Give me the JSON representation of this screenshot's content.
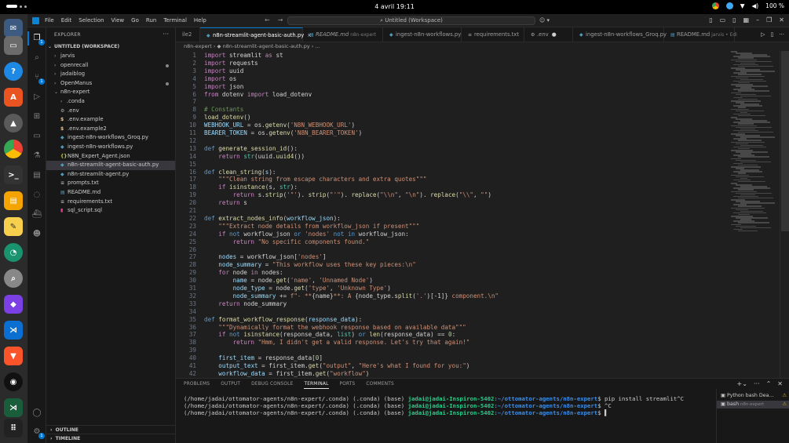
{
  "topbar": {
    "clock": "4 avril  19:11",
    "battery": "100 %"
  },
  "titlebar": {
    "menu": [
      "File",
      "Edit",
      "Selection",
      "View",
      "Go",
      "Run",
      "Terminal",
      "Help"
    ],
    "command_center": "Untitled (Workspace)"
  },
  "activity_badges": {
    "explorer": "1",
    "source_control": "1",
    "accounts": "1"
  },
  "explorer": {
    "header": "EXPLORER",
    "workspace": "UNTITLED (WORKSPACE)",
    "items": [
      {
        "label": "jarvis",
        "type": "folder",
        "open": false,
        "depth": 1
      },
      {
        "label": "openrecall",
        "type": "folder",
        "open": false,
        "depth": 1,
        "modified": true
      },
      {
        "label": "jadaiblog",
        "type": "folder",
        "open": false,
        "depth": 1
      },
      {
        "label": "OpenManus",
        "type": "folder",
        "open": false,
        "depth": 1,
        "modified": true
      },
      {
        "label": "n8n-expert",
        "type": "folder",
        "open": true,
        "depth": 1
      },
      {
        "label": ".conda",
        "type": "folder",
        "open": false,
        "depth": 2
      },
      {
        "label": ".env",
        "type": "gear",
        "depth": 2
      },
      {
        "label": ".env.example",
        "type": "dollar",
        "depth": 2
      },
      {
        "label": ".env.example2",
        "type": "dollar",
        "depth": 2
      },
      {
        "label": "ingest-n8n-workflows_Groq.py",
        "type": "py",
        "depth": 2
      },
      {
        "label": "ingest-n8n-workflows.py",
        "type": "py",
        "depth": 2
      },
      {
        "label": "N8N_Expert_Agent.json",
        "type": "json",
        "depth": 2
      },
      {
        "label": "n8n-streamlit-agent-basic-auth.py",
        "type": "py",
        "depth": 2,
        "selected": true
      },
      {
        "label": "n8n-streamlit-agent.py",
        "type": "py",
        "depth": 2
      },
      {
        "label": "prompts.txt",
        "type": "txt",
        "depth": 2
      },
      {
        "label": "README.md",
        "type": "md",
        "depth": 2
      },
      {
        "label": "requirements.txt",
        "type": "txt",
        "depth": 2
      },
      {
        "label": "sql_script.sql",
        "type": "sql",
        "depth": 2
      }
    ],
    "outline": "OUTLINE",
    "timeline": "TIMELINE"
  },
  "tabs": [
    {
      "label": "ile2",
      "icon": "",
      "active": false
    },
    {
      "label": "n8n-streamlit-agent-basic-auth.py",
      "icon": "py",
      "active": true,
      "close": "×"
    },
    {
      "label": "README.md",
      "desc": "n8n-expert",
      "icon": "md",
      "italic": true
    },
    {
      "label": "ingest-n8n-workflows.py",
      "icon": "py"
    },
    {
      "label": "requirements.txt",
      "icon": "txt"
    },
    {
      "label": ".env",
      "icon": "gear",
      "dirty": true
    },
    {
      "label": "ingest-n8n-workflows_Groq.py",
      "icon": "py"
    },
    {
      "label": "README.md",
      "desc": "jarvis • Edi",
      "icon": "md"
    }
  ],
  "breadcrumb": "n8n-expert  ›  ◆ n8n-streamlit-agent-basic-auth.py  ›  ...",
  "code": [
    [
      [
        "k",
        "import"
      ],
      [
        "t",
        " streamlit "
      ],
      [
        "k",
        "as"
      ],
      [
        "t",
        " st"
      ]
    ],
    [
      [
        "k",
        "import"
      ],
      [
        "t",
        " requests"
      ]
    ],
    [
      [
        "k",
        "import"
      ],
      [
        "t",
        " uuid"
      ]
    ],
    [
      [
        "k",
        "import"
      ],
      [
        "t",
        " os"
      ]
    ],
    [
      [
        "k",
        "import"
      ],
      [
        "t",
        " json"
      ]
    ],
    [
      [
        "k",
        "from"
      ],
      [
        "t",
        " dotenv "
      ],
      [
        "k",
        "import"
      ],
      [
        "t",
        " load_dotenv"
      ]
    ],
    [],
    [
      [
        "c",
        "# Constants"
      ]
    ],
    [
      [
        "f",
        "load_dotenv"
      ],
      [
        "t",
        "()"
      ]
    ],
    [
      [
        "v",
        "WEBHOOK_URL"
      ],
      [
        "t",
        " = os."
      ],
      [
        "f",
        "getenv"
      ],
      [
        "t",
        "("
      ],
      [
        "s",
        "'N8N_WEBHOOK_URL'"
      ],
      [
        "t",
        ")"
      ]
    ],
    [
      [
        "v",
        "BEARER_TOKEN"
      ],
      [
        "t",
        " = os."
      ],
      [
        "f",
        "getenv"
      ],
      [
        "t",
        "("
      ],
      [
        "s",
        "'N8N_BEARER_TOKEN'"
      ],
      [
        "t",
        ")"
      ]
    ],
    [],
    [
      [
        "kd",
        "def"
      ],
      [
        "t",
        " "
      ],
      [
        "f",
        "generate_session_id"
      ],
      [
        "t",
        "():"
      ]
    ],
    [
      [
        "t",
        "    "
      ],
      [
        "k",
        "return"
      ],
      [
        "t",
        " "
      ],
      [
        "cls",
        "str"
      ],
      [
        "t",
        "(uuid."
      ],
      [
        "f",
        "uuid4"
      ],
      [
        "t",
        "())"
      ]
    ],
    [],
    [
      [
        "kd",
        "def"
      ],
      [
        "t",
        " "
      ],
      [
        "f",
        "clean_string"
      ],
      [
        "t",
        "("
      ],
      [
        "v",
        "s"
      ],
      [
        "t",
        "):"
      ]
    ],
    [
      [
        "t",
        "    "
      ],
      [
        "s",
        "\"\"\"Clean string from escape characters and extra quotes\"\"\""
      ]
    ],
    [
      [
        "t",
        "    "
      ],
      [
        "k",
        "if"
      ],
      [
        "t",
        " "
      ],
      [
        "f",
        "isinstance"
      ],
      [
        "t",
        "(s, "
      ],
      [
        "cls",
        "str"
      ],
      [
        "t",
        "):"
      ]
    ],
    [
      [
        "t",
        "        "
      ],
      [
        "k",
        "return"
      ],
      [
        "t",
        " s."
      ],
      [
        "f",
        "strip"
      ],
      [
        "t",
        "("
      ],
      [
        "s",
        "'\"'"
      ],
      [
        "t",
        "). "
      ],
      [
        "f",
        "strip"
      ],
      [
        "t",
        "("
      ],
      [
        "s",
        "\"'\""
      ],
      [
        "t",
        "). "
      ],
      [
        "f",
        "replace"
      ],
      [
        "t",
        "("
      ],
      [
        "s",
        "\"\\\\n\""
      ],
      [
        "t",
        ", "
      ],
      [
        "s",
        "\"\\n\""
      ],
      [
        "t",
        "). "
      ],
      [
        "f",
        "replace"
      ],
      [
        "t",
        "("
      ],
      [
        "s",
        "\"\\\\\""
      ],
      [
        "t",
        ", "
      ],
      [
        "s",
        "\"\""
      ],
      [
        "t",
        ")"
      ]
    ],
    [
      [
        "t",
        "    "
      ],
      [
        "k",
        "return"
      ],
      [
        "t",
        " s"
      ]
    ],
    [],
    [
      [
        "kd",
        "def"
      ],
      [
        "t",
        " "
      ],
      [
        "f",
        "extract_nodes_info"
      ],
      [
        "t",
        "("
      ],
      [
        "v",
        "workflow_json"
      ],
      [
        "t",
        "):"
      ]
    ],
    [
      [
        "t",
        "    "
      ],
      [
        "s",
        "\"\"\"Extract node details from workflow_json if present\"\"\""
      ]
    ],
    [
      [
        "t",
        "    "
      ],
      [
        "k",
        "if"
      ],
      [
        "t",
        " "
      ],
      [
        "kd",
        "not"
      ],
      [
        "t",
        " workflow_json "
      ],
      [
        "kd",
        "or"
      ],
      [
        "t",
        " "
      ],
      [
        "s",
        "'nodes'"
      ],
      [
        "t",
        " "
      ],
      [
        "kd",
        "not in"
      ],
      [
        "t",
        " workflow_json:"
      ]
    ],
    [
      [
        "t",
        "        "
      ],
      [
        "k",
        "return"
      ],
      [
        "t",
        " "
      ],
      [
        "s",
        "\"No specific components found.\""
      ]
    ],
    [],
    [
      [
        "t",
        "    "
      ],
      [
        "v",
        "nodes"
      ],
      [
        "t",
        " = workflow_json["
      ],
      [
        "s",
        "'nodes'"
      ],
      [
        "t",
        "]"
      ]
    ],
    [
      [
        "t",
        "    "
      ],
      [
        "v",
        "node_summary"
      ],
      [
        "t",
        " = "
      ],
      [
        "s",
        "\"This workflow uses these key pieces:\\n\""
      ]
    ],
    [
      [
        "t",
        "    "
      ],
      [
        "k",
        "for"
      ],
      [
        "t",
        " node "
      ],
      [
        "k",
        "in"
      ],
      [
        "t",
        " nodes:"
      ]
    ],
    [
      [
        "t",
        "        "
      ],
      [
        "v",
        "name"
      ],
      [
        "t",
        " = node."
      ],
      [
        "f",
        "get"
      ],
      [
        "t",
        "("
      ],
      [
        "s",
        "'name'"
      ],
      [
        "t",
        ", "
      ],
      [
        "s",
        "'Unnamed Node'"
      ],
      [
        "t",
        ")"
      ]
    ],
    [
      [
        "t",
        "        "
      ],
      [
        "v",
        "node_type"
      ],
      [
        "t",
        " = node."
      ],
      [
        "f",
        "get"
      ],
      [
        "t",
        "("
      ],
      [
        "s",
        "'type'"
      ],
      [
        "t",
        ", "
      ],
      [
        "s",
        "'Unknown Type'"
      ],
      [
        "t",
        ")"
      ]
    ],
    [
      [
        "t",
        "        "
      ],
      [
        "v",
        "node_summary"
      ],
      [
        "t",
        " += "
      ],
      [
        "s",
        "f\"- **"
      ],
      [
        "t",
        "{name}"
      ],
      [
        "s",
        "**: A "
      ],
      [
        "t",
        "{node_type."
      ],
      [
        "f",
        "split"
      ],
      [
        "t",
        "("
      ],
      [
        "s",
        "'.'"
      ],
      [
        "t",
        ")[-1]}"
      ],
      [
        "s",
        " component.\\n\""
      ]
    ],
    [
      [
        "t",
        "    "
      ],
      [
        "k",
        "return"
      ],
      [
        "t",
        " node_summary"
      ]
    ],
    [],
    [
      [
        "kd",
        "def"
      ],
      [
        "t",
        " "
      ],
      [
        "f",
        "format_workflow_response"
      ],
      [
        "t",
        "("
      ],
      [
        "v",
        "response_data"
      ],
      [
        "t",
        "):"
      ]
    ],
    [
      [
        "t",
        "    "
      ],
      [
        "s",
        "\"\"\"Dynamically format the webhook response based on available data\"\"\""
      ]
    ],
    [
      [
        "t",
        "    "
      ],
      [
        "k",
        "if"
      ],
      [
        "t",
        " "
      ],
      [
        "kd",
        "not"
      ],
      [
        "t",
        " "
      ],
      [
        "f",
        "isinstance"
      ],
      [
        "t",
        "(response_data, "
      ],
      [
        "cls",
        "list"
      ],
      [
        "t",
        ") "
      ],
      [
        "kd",
        "or"
      ],
      [
        "t",
        " "
      ],
      [
        "f",
        "len"
      ],
      [
        "t",
        "(response_data) == "
      ],
      [
        "n",
        "0"
      ],
      [
        "t",
        ":"
      ]
    ],
    [
      [
        "t",
        "        "
      ],
      [
        "k",
        "return"
      ],
      [
        "t",
        " "
      ],
      [
        "s",
        "\"Hmm, I didn't get a valid response. Let's try that again!\""
      ]
    ],
    [],
    [
      [
        "t",
        "    "
      ],
      [
        "v",
        "first_item"
      ],
      [
        "t",
        " = response_data["
      ],
      [
        "n",
        "0"
      ],
      [
        "t",
        "]"
      ]
    ],
    [
      [
        "t",
        "    "
      ],
      [
        "v",
        "output_text"
      ],
      [
        "t",
        " = first_item."
      ],
      [
        "f",
        "get"
      ],
      [
        "t",
        "("
      ],
      [
        "s",
        "\"output\""
      ],
      [
        "t",
        ", "
      ],
      [
        "s",
        "\"Here's what I found for you:\""
      ],
      [
        "t",
        ")"
      ]
    ],
    [
      [
        "t",
        "    "
      ],
      [
        "v",
        "workflow_data"
      ],
      [
        "t",
        " = first_item."
      ],
      [
        "f",
        "get"
      ],
      [
        "t",
        "("
      ],
      [
        "s",
        "\"workflow\""
      ],
      [
        "t",
        ")"
      ]
    ]
  ],
  "panel": {
    "tabs": [
      "PROBLEMS",
      "OUTPUT",
      "DEBUG CONSOLE",
      "TERMINAL",
      "PORTS",
      "COMMENTS"
    ],
    "active_tab": "TERMINAL",
    "terminal": [
      {
        "prefix": "(/home/jadai/ottomator-agents/n8n-expert/.conda) (.conda) (base) ",
        "user": "jadai@jadai-Inspiron-5402",
        "path": ":~/ottomator-agents/n8n-expert",
        "cmd": "$ pip install streamlit^C"
      },
      {
        "prefix": "(/home/jadai/ottomator-agents/n8n-expert/.conda) (.conda) (base) ",
        "user": "jadai@jadai-Inspiron-5402",
        "path": ":~/ottomator-agents/n8n-expert",
        "cmd": "$ ^C"
      },
      {
        "prefix": "(/home/jadai/ottomator-agents/n8n-expert/.conda) (.conda) (base) ",
        "user": "jadai@jadai-Inspiron-5402",
        "path": ":~/ottomator-agents/n8n-expert",
        "cmd": "$ ▌"
      }
    ],
    "terminals": [
      {
        "label": "Python bash Dea...",
        "desc": "",
        "warn": "⚠"
      },
      {
        "label": "bash",
        "desc": "n8n-expert",
        "warn": "⚠",
        "selected": true
      }
    ]
  },
  "colors": {
    "accent": "#0078d4",
    "editor_bg": "#1f1f1f",
    "sidebar_bg": "#181818"
  }
}
